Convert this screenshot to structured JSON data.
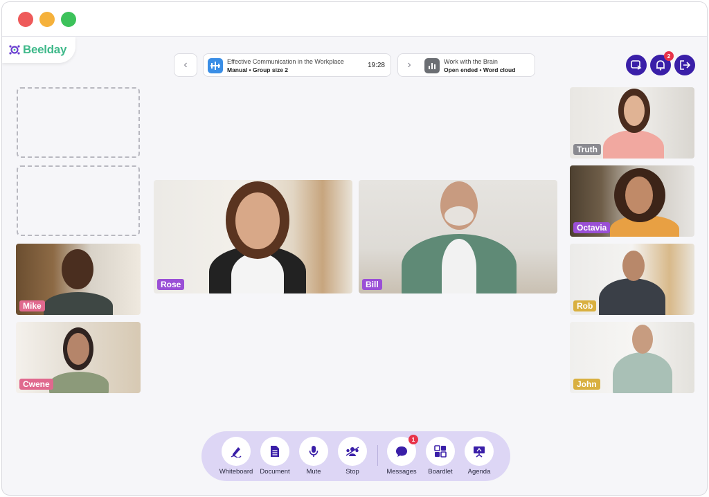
{
  "app": {
    "name": "Beelday"
  },
  "current_session": {
    "title": "Effective Communication in the Workplace",
    "mode": "Manual",
    "group": "Group size 2",
    "time": "19:28"
  },
  "next_session": {
    "title": "Work with the Brain",
    "mode": "Open ended",
    "type": "Word cloud"
  },
  "notifications": {
    "count": "2"
  },
  "participants": {
    "mike": "Mike",
    "cwene": "Cwene",
    "rose": "Rose",
    "bill": "Bill",
    "truth": "Truth",
    "octavia": "Octavia",
    "rob": "Rob",
    "john": "John"
  },
  "toolbar": {
    "whiteboard": "Whiteboard",
    "document": "Document",
    "mute": "Mute",
    "stop": "Stop",
    "messages": "Messages",
    "messages_badge": "1",
    "boardlet": "Boardlet",
    "agenda": "Agenda"
  },
  "colors": {
    "accent": "#3a1fa8",
    "brand": "#3fb98a",
    "toolbar_bg": "#ddd6f5",
    "label_pink": "#e0698e",
    "label_purple": "#9a4fd6",
    "label_gray": "#8a8a90",
    "label_yellow": "#d9b040"
  }
}
